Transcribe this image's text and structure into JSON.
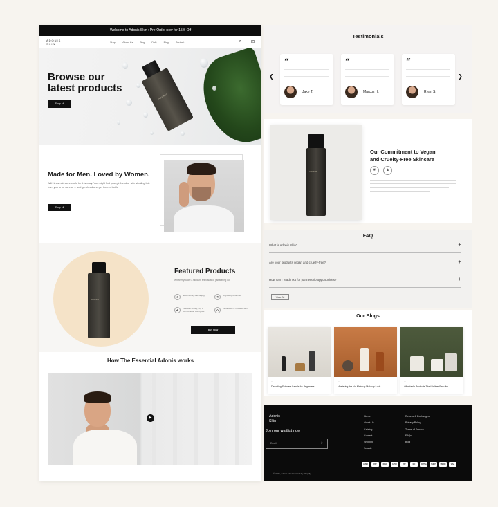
{
  "announcement": "Welcome to Adonis Skin : Pre-Order now for 15% Off",
  "brand": {
    "line1": "ADONIS",
    "line2": "SKIN"
  },
  "nav": {
    "links": [
      "Shop",
      "About Us",
      "Blog",
      "FAQ",
      "Blog",
      "Contact"
    ]
  },
  "hero": {
    "headline_line1": "Browse our",
    "headline_line2": "latest products",
    "cta": "Shop All",
    "bottle_label": "ADONIS"
  },
  "made": {
    "title": "Made for Men. Loved by Women.",
    "body": "With know-skincare could be this easy. You might find your girlfriend or wife stealing this from you to be careful ... and go ahead and get them a bottle",
    "cta": "Shop All"
  },
  "featured": {
    "title": "Featured Products",
    "body": "Whether you are a skincare enthusiast or just starting out",
    "features": [
      {
        "icon": "♻",
        "text": "Eco-friendly Packaging"
      },
      {
        "icon": "⚗",
        "text": "Lightweight formula"
      },
      {
        "icon": "✚",
        "text": "Suitable for dry, oily & combination skin types"
      },
      {
        "icon": "✿",
        "text": "Nourishes & hydrates skin"
      }
    ],
    "cta": "Buy Now",
    "bottle_label": "ADONIS"
  },
  "works": {
    "title": "How The Essential Adonis works"
  },
  "testimonials": {
    "title": "Testimonials",
    "items": [
      {
        "name": "Jake T."
      },
      {
        "name": "Marcus H."
      },
      {
        "name": "Ryan S."
      }
    ]
  },
  "vegan": {
    "title_line1": "Our Commitment to Vegan",
    "title_line2": "and Cruelty-Free Skincare",
    "bottle_label": "ADONIS"
  },
  "faq": {
    "title": "FAQ",
    "items": [
      {
        "q": "What is Adonis Skin?"
      },
      {
        "q": "Are your products vegan and cruelty-free?"
      },
      {
        "q": "How can I reach out for partnership opportunities?"
      }
    ],
    "more": "View All"
  },
  "blogs": {
    "title": "Our Blogs",
    "items": [
      {
        "title": "Decoding Skincare Labels for Beginners"
      },
      {
        "title": "Mastering the No-Makeup Makeup Look"
      },
      {
        "title": "Affordable Products That Deliver Results"
      }
    ]
  },
  "footer": {
    "brand_line1": "Adonis",
    "brand_line2": "Skin",
    "waitlist": "Join our waitlist now",
    "email_placeholder": "Email",
    "col1": [
      "Home",
      "About Us",
      "Catalog",
      "Contact",
      "Shipping",
      "Search"
    ],
    "col2": [
      "Returns & Exchanges",
      "Privacy Policy",
      "Terms of Service",
      "FAQs",
      "Blog"
    ],
    "payments": [
      "AMEX",
      "PAY",
      "DISC",
      "G PAY",
      "PAY",
      "MC",
      "PAYPAL",
      "SHOP",
      "UNION",
      "VISA"
    ],
    "copyright": "© 2025, Adonis skin Powered by Shopify"
  },
  "colors": {
    "accent_dark": "#0d0d0d",
    "cream_glow": "#f5e3c8",
    "leaf_green": "#24481b"
  }
}
